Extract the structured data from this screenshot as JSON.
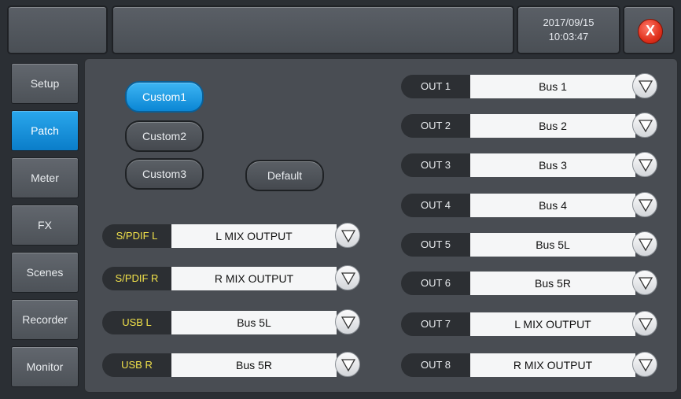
{
  "header": {
    "date": "2017/09/15",
    "time": "10:03:47",
    "close_icon": "X"
  },
  "sidebar": {
    "items": [
      {
        "label": "Setup"
      },
      {
        "label": "Patch"
      },
      {
        "label": "Meter"
      },
      {
        "label": "FX"
      },
      {
        "label": "Scenes"
      },
      {
        "label": "Recorder"
      },
      {
        "label": "Monitor"
      }
    ],
    "active": "Patch"
  },
  "presets": {
    "custom1": "Custom1",
    "custom2": "Custom2",
    "custom3": "Custom3",
    "default": "Default",
    "active": "Custom1"
  },
  "inputs": [
    {
      "tag": "S/PDIF L",
      "value": "L MIX OUTPUT"
    },
    {
      "tag": "S/PDIF R",
      "value": "R MIX OUTPUT"
    },
    {
      "tag": "USB L",
      "value": "Bus 5L"
    },
    {
      "tag": "USB R",
      "value": "Bus 5R"
    }
  ],
  "outputs": [
    {
      "tag": "OUT 1",
      "value": "Bus 1"
    },
    {
      "tag": "OUT 2",
      "value": "Bus 2"
    },
    {
      "tag": "OUT 3",
      "value": "Bus 3"
    },
    {
      "tag": "OUT 4",
      "value": "Bus 4"
    },
    {
      "tag": "OUT 5",
      "value": "Bus 5L"
    },
    {
      "tag": "OUT 6",
      "value": "Bus 5R"
    },
    {
      "tag": "OUT 7",
      "value": "L MIX OUTPUT"
    },
    {
      "tag": "OUT 8",
      "value": "R MIX OUTPUT"
    }
  ],
  "colors": {
    "accent": "#0a7dc9",
    "input_tag_text": "#f2e24a",
    "close": "#e0301c"
  }
}
